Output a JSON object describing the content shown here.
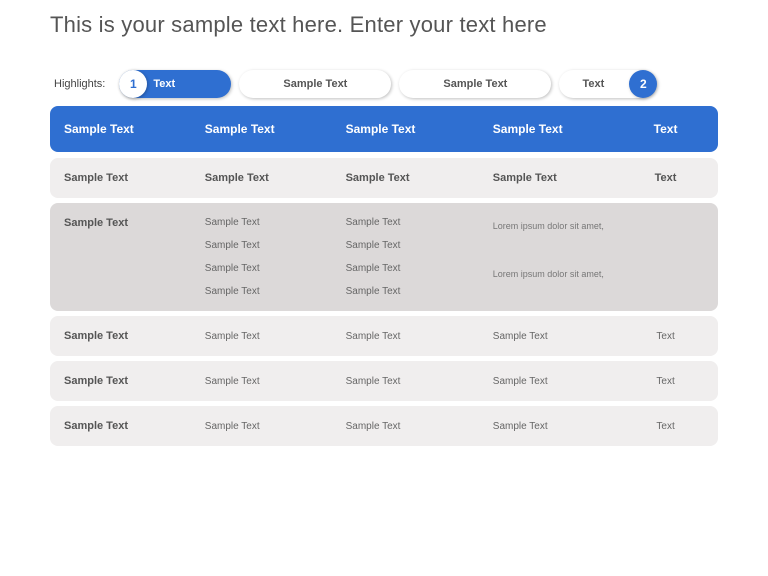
{
  "title": "This is your sample text here. Enter your text here",
  "highlights_label": "Highlights:",
  "pills": {
    "p1": {
      "badge": "1",
      "text": "Text"
    },
    "p2": {
      "text": "Sample Text"
    },
    "p3": {
      "text": "Sample Text"
    },
    "p4": {
      "text": "Text",
      "badge": "2"
    }
  },
  "header": {
    "c1": "Sample Text",
    "c2": "Sample Text",
    "c3": "Sample Text",
    "c4": "Sample Text",
    "c5": "Text"
  },
  "row1": {
    "c1": "Sample Text",
    "c2": "Sample Text",
    "c3": "Sample Text",
    "c4": "Sample Text",
    "c5": "Text"
  },
  "row2": {
    "c1": "Sample Text",
    "c2a": "Sample Text",
    "c2b": "Sample Text",
    "c2c": "Sample Text",
    "c2d": "Sample Text",
    "c3a": "Sample Text",
    "c3b": "Sample Text",
    "c3c": "Sample Text",
    "c3d": "Sample Text",
    "c4a": "Lorem ipsum dolor sit amet,",
    "c4b": "Lorem ipsum dolor sit amet,"
  },
  "row3": {
    "c1": "Sample Text",
    "c2": "Sample Text",
    "c3": "Sample Text",
    "c4": "Sample Text",
    "c5": "Text"
  },
  "row4": {
    "c1": "Sample Text",
    "c2": "Sample Text",
    "c3": "Sample Text",
    "c4": "Sample Text",
    "c5": "Text"
  },
  "row5": {
    "c1": "Sample Text",
    "c2": "Sample Text",
    "c3": "Sample Text",
    "c4": "Sample Text",
    "c5": "Text"
  }
}
